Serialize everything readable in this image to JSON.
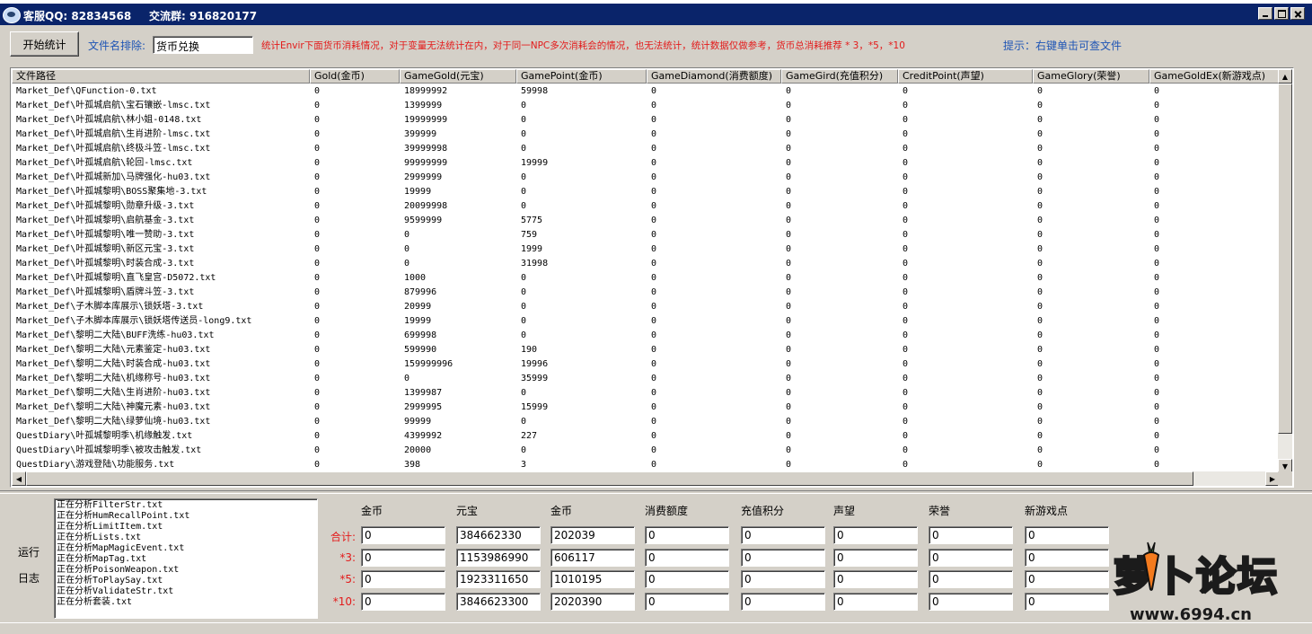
{
  "window": {
    "qq_label": "客服QQ: 82834568",
    "group_label": "交流群: 916820177"
  },
  "toolbar": {
    "start_button": "开始统计",
    "exclude_label": "文件名排除:",
    "exclude_value": "货币兑换",
    "notice": "统计Envir下面货币消耗情况，对于变量无法统计在内，对于同一NPC多次消耗会的情况，也无法统计，统计数据仅做参考，货币总消耗推荐 * 3，*5，*10",
    "hint": "提示：右键单击可查文件"
  },
  "table": {
    "columns": [
      "文件路径",
      "Gold(金币)",
      "GameGold(元宝)",
      "GamePoint(金币)",
      "GameDiamond(消费额度)",
      "GameGird(充值积分)",
      "CreditPoint(声望)",
      "GameGlory(荣誉)",
      "GameGoldEx(新游戏点)"
    ],
    "rows": [
      [
        "Market_Def\\QFunction-0.txt",
        "0",
        "18999992",
        "59998",
        "0",
        "0",
        "0",
        "0",
        "0"
      ],
      [
        "Market_Def\\叶孤城启航\\宝石镶嵌-lmsc.txt",
        "0",
        "1399999",
        "0",
        "0",
        "0",
        "0",
        "0",
        "0"
      ],
      [
        "Market_Def\\叶孤城启航\\林小姐-0148.txt",
        "0",
        "19999999",
        "0",
        "0",
        "0",
        "0",
        "0",
        "0"
      ],
      [
        "Market_Def\\叶孤城启航\\生肖进阶-lmsc.txt",
        "0",
        "399999",
        "0",
        "0",
        "0",
        "0",
        "0",
        "0"
      ],
      [
        "Market_Def\\叶孤城启航\\终极斗笠-lmsc.txt",
        "0",
        "39999998",
        "0",
        "0",
        "0",
        "0",
        "0",
        "0"
      ],
      [
        "Market_Def\\叶孤城启航\\轮回-lmsc.txt",
        "0",
        "99999999",
        "19999",
        "0",
        "0",
        "0",
        "0",
        "0"
      ],
      [
        "Market_Def\\叶孤城新加\\马牌强化-hu03.txt",
        "0",
        "2999999",
        "0",
        "0",
        "0",
        "0",
        "0",
        "0"
      ],
      [
        "Market_Def\\叶孤城黎明\\BOSS聚集地-3.txt",
        "0",
        "19999",
        "0",
        "0",
        "0",
        "0",
        "0",
        "0"
      ],
      [
        "Market_Def\\叶孤城黎明\\勋章升级-3.txt",
        "0",
        "20099998",
        "0",
        "0",
        "0",
        "0",
        "0",
        "0"
      ],
      [
        "Market_Def\\叶孤城黎明\\启航基金-3.txt",
        "0",
        "9599999",
        "5775",
        "0",
        "0",
        "0",
        "0",
        "0"
      ],
      [
        "Market_Def\\叶孤城黎明\\唯一赞助-3.txt",
        "0",
        "0",
        "759",
        "0",
        "0",
        "0",
        "0",
        "0"
      ],
      [
        "Market_Def\\叶孤城黎明\\新区元宝-3.txt",
        "0",
        "0",
        "1999",
        "0",
        "0",
        "0",
        "0",
        "0"
      ],
      [
        "Market_Def\\叶孤城黎明\\时装合成-3.txt",
        "0",
        "0",
        "31998",
        "0",
        "0",
        "0",
        "0",
        "0"
      ],
      [
        "Market_Def\\叶孤城黎明\\直飞皇宫-D5072.txt",
        "0",
        "1000",
        "0",
        "0",
        "0",
        "0",
        "0",
        "0"
      ],
      [
        "Market_Def\\叶孤城黎明\\盾牌斗笠-3.txt",
        "0",
        "879996",
        "0",
        "0",
        "0",
        "0",
        "0",
        "0"
      ],
      [
        "Market_Def\\子木脚本库展示\\锁妖塔-3.txt",
        "0",
        "20999",
        "0",
        "0",
        "0",
        "0",
        "0",
        "0"
      ],
      [
        "Market_Def\\子木脚本库展示\\锁妖塔传送员-long9.txt",
        "0",
        "19999",
        "0",
        "0",
        "0",
        "0",
        "0",
        "0"
      ],
      [
        "Market_Def\\黎明二大陆\\BUFF洗练-hu03.txt",
        "0",
        "699998",
        "0",
        "0",
        "0",
        "0",
        "0",
        "0"
      ],
      [
        "Market_Def\\黎明二大陆\\元素鉴定-hu03.txt",
        "0",
        "599990",
        "190",
        "0",
        "0",
        "0",
        "0",
        "0"
      ],
      [
        "Market_Def\\黎明二大陆\\时装合成-hu03.txt",
        "0",
        "159999996",
        "19996",
        "0",
        "0",
        "0",
        "0",
        "0"
      ],
      [
        "Market_Def\\黎明二大陆\\机缘称号-hu03.txt",
        "0",
        "0",
        "35999",
        "0",
        "0",
        "0",
        "0",
        "0"
      ],
      [
        "Market_Def\\黎明二大陆\\生肖进阶-hu03.txt",
        "0",
        "1399987",
        "0",
        "0",
        "0",
        "0",
        "0",
        "0"
      ],
      [
        "Market_Def\\黎明二大陆\\神魔元素-hu03.txt",
        "0",
        "2999995",
        "15999",
        "0",
        "0",
        "0",
        "0",
        "0"
      ],
      [
        "Market_Def\\黎明二大陆\\绿萝仙境-hu03.txt",
        "0",
        "99999",
        "0",
        "0",
        "0",
        "0",
        "0",
        "0"
      ],
      [
        "QuestDiary\\叶孤城黎明季\\机缘触发.txt",
        "0",
        "4399992",
        "227",
        "0",
        "0",
        "0",
        "0",
        "0"
      ],
      [
        "QuestDiary\\叶孤城黎明季\\被攻击触发.txt",
        "0",
        "20000",
        "0",
        "0",
        "0",
        "0",
        "0",
        "0"
      ],
      [
        "QuestDiary\\游戏登陆\\功能服务.txt",
        "0",
        "398",
        "3",
        "0",
        "0",
        "0",
        "0",
        "0"
      ]
    ]
  },
  "log": {
    "label_line1": "运行",
    "label_line2": "日志",
    "lines": [
      "正在分析FilterStr.txt",
      "正在分析HumRecallPoint.txt",
      "正在分析LimitItem.txt",
      "正在分析Lists.txt",
      "正在分析MapMagicEvent.txt",
      "正在分析MapTag.txt",
      "正在分析PoisonWeapon.txt",
      "正在分析ToPlaySay.txt",
      "正在分析ValidateStr.txt",
      "正在分析套装.txt"
    ]
  },
  "summary": {
    "headers": [
      "金币",
      "元宝",
      "金币",
      "消费额度",
      "充值积分",
      "声望",
      "荣誉",
      "新游戏点"
    ],
    "rows": [
      {
        "label": "合计:",
        "values": [
          "0",
          "384662330",
          "202039",
          "0",
          "0",
          "0",
          "0",
          "0"
        ]
      },
      {
        "label": "*3:",
        "values": [
          "0",
          "1153986990",
          "606117",
          "0",
          "0",
          "0",
          "0",
          "0"
        ]
      },
      {
        "label": "*5:",
        "values": [
          "0",
          "1923311650",
          "1010195",
          "0",
          "0",
          "0",
          "0",
          "0"
        ]
      },
      {
        "label": "*10:",
        "values": [
          "0",
          "3846623300",
          "2020390",
          "0",
          "0",
          "0",
          "0",
          "0"
        ]
      }
    ]
  },
  "watermark": {
    "title": "萝卜论坛",
    "url": "www.6994.cn"
  }
}
